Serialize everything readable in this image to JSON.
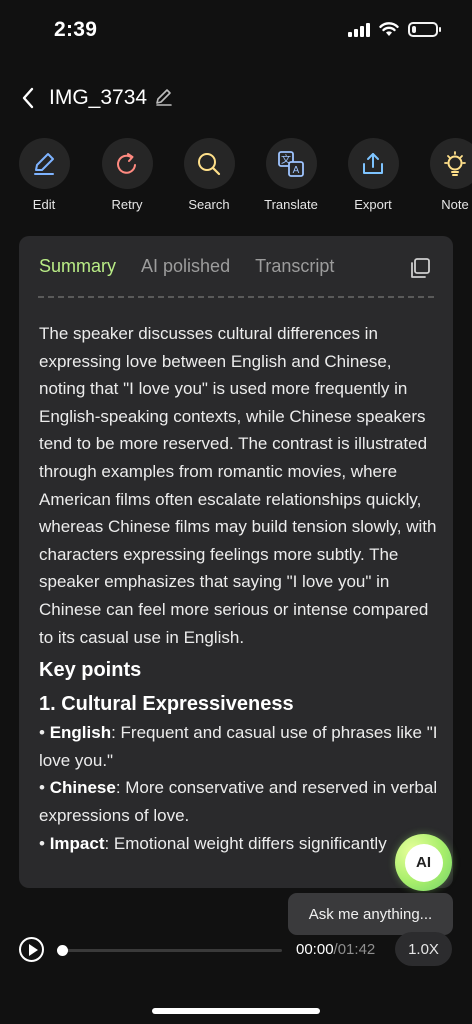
{
  "status_bar": {
    "time": "2:39",
    "signal_icon": "cellular-signal-icon",
    "wifi_icon": "wifi-icon",
    "battery_icon": "battery-icon",
    "battery_level": 0.3
  },
  "header": {
    "title": "IMG_3734",
    "back_icon": "chevron-left-icon",
    "rename_icon": "pencil-icon"
  },
  "toolbar": {
    "items": [
      {
        "label": "Edit",
        "icon": "pencil-icon"
      },
      {
        "label": "Retry",
        "icon": "retry-icon"
      },
      {
        "label": "Search",
        "icon": "search-icon"
      },
      {
        "label": "Translate",
        "icon": "translate-icon"
      },
      {
        "label": "Export",
        "icon": "export-icon"
      },
      {
        "label": "Note",
        "icon": "lightbulb-icon"
      }
    ]
  },
  "card": {
    "tabs": [
      {
        "label": "Summary",
        "active": true
      },
      {
        "label": "AI polished",
        "active": false
      },
      {
        "label": "Transcript",
        "active": false
      }
    ],
    "copy_icon": "copy-icon",
    "summary_text": "The speaker discusses cultural differences in expressing love between English and Chinese, noting that \"I love you\" is used more frequently in English-speaking contexts, while Chinese speakers tend to be more reserved. The contrast is illustrated through examples from romantic movies, where American films often escalate relationships quickly, whereas Chinese films may build tension slowly, with characters expressing feelings more subtly. The speaker emphasizes that saying \"I love you\" in Chinese can feel more serious or intense compared to its casual use in English.",
    "key_points_heading": "Key points",
    "section_1_heading": "1. Cultural Expressiveness",
    "bullets": [
      {
        "term": "English",
        "text": ": Frequent and casual use of phrases like \"I love you.\""
      },
      {
        "term": "Chinese",
        "text": ": More conservative and reserved in verbal expressions of love."
      },
      {
        "term": "Impact",
        "text": ": Emotional weight differs significantly"
      }
    ]
  },
  "ai_assistant": {
    "badge": "AI",
    "prompt": "Ask me anything..."
  },
  "player": {
    "current_time": "00:00",
    "separator": "/",
    "total_time": "01:42",
    "speed": "1.0X",
    "progress": 0.0,
    "play_icon": "play-icon"
  },
  "colors": {
    "accent_green": "#b9ec86",
    "background": "#111111",
    "card": "#2a2a2c"
  }
}
